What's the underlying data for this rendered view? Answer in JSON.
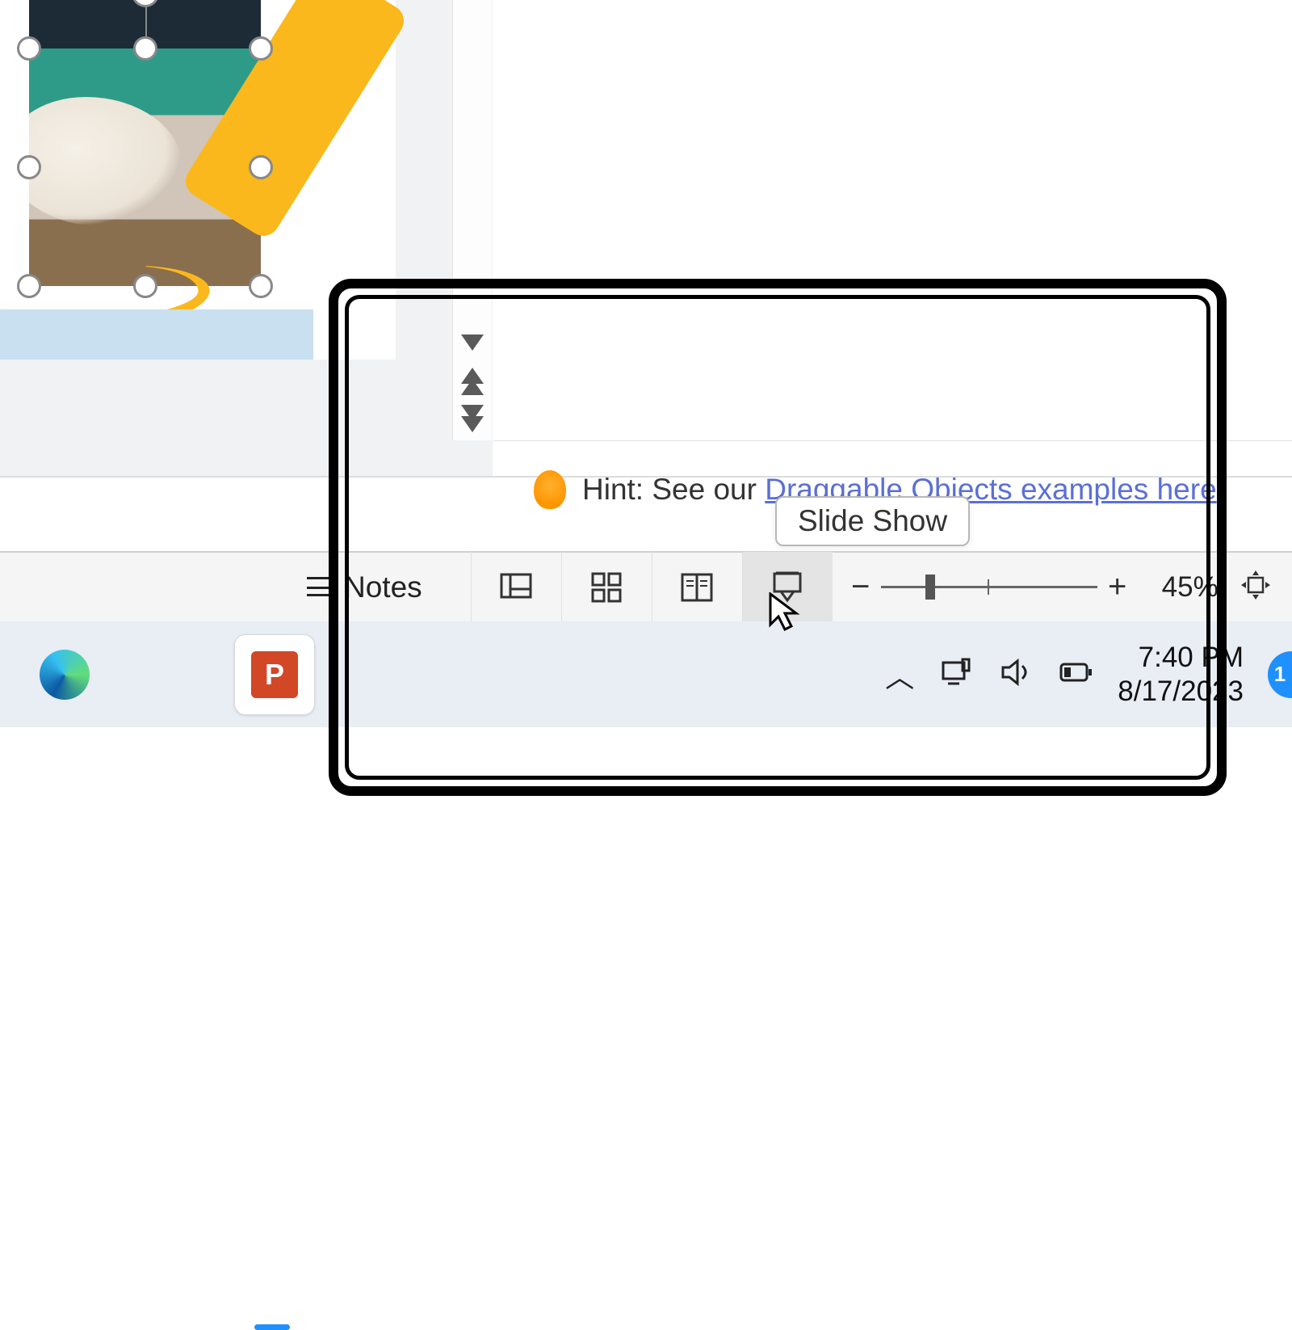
{
  "hint": {
    "prefix": "Hint: See our ",
    "link_text": "Draggable Objects examples here"
  },
  "tooltip": {
    "label": "Slide Show"
  },
  "statusbar": {
    "notes_label": "Notes",
    "zoom_percent": "45%"
  },
  "taskbar": {
    "ppt_letter": "P",
    "time": "7:40 PM",
    "date": "8/17/2023",
    "notif_count": "1"
  }
}
